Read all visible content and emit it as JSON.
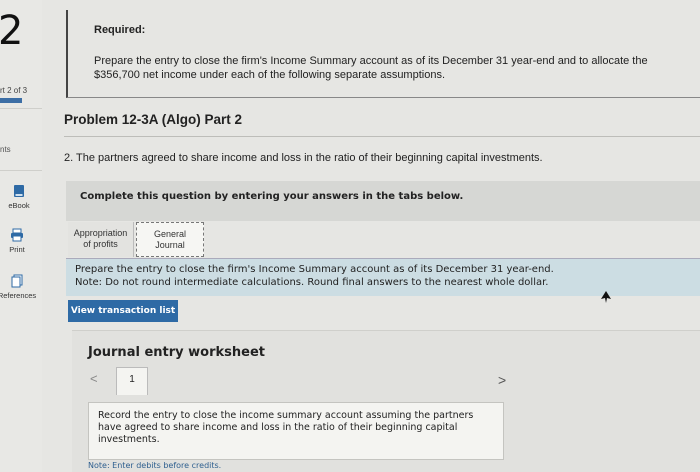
{
  "sidebar": {
    "question_number": "2",
    "part_label": "rt 2 of 3",
    "points_label": "nts",
    "tools": [
      {
        "label": "eBook",
        "icon": "book-icon"
      },
      {
        "label": "Print",
        "icon": "printer-icon"
      },
      {
        "label": "References",
        "icon": "references-icon"
      }
    ]
  },
  "required": {
    "title": "Required:",
    "text": "Prepare the entry to close the firm's Income Summary account as of its December 31 year-end and to allocate the $356,700 net income under each of the following separate assumptions."
  },
  "problem": {
    "title": "Problem 12-3A (Algo) Part 2",
    "question": "2. The partners agreed to share income and loss in the ratio of their beginning capital investments."
  },
  "instruction": "Complete this question by entering your answers in the tabs below.",
  "tabs": [
    {
      "line1": "Appropriation",
      "line2": "of profits"
    },
    {
      "line1": "General",
      "line2": "Journal"
    }
  ],
  "panel": {
    "line1": "Prepare the entry to close the firm's Income Summary account as of its December 31 year-end.",
    "line2": "Note: Do not round intermediate calculations. Round final answers to the nearest whole dollar."
  },
  "view_button": "View transaction list",
  "worksheet": {
    "title": "Journal entry worksheet",
    "prev": "<",
    "page": "1",
    "next": ">",
    "record_text": "Record the entry to close the income summary account assuming the partners have agreed to share income and loss in the ratio of their beginning capital investments.",
    "note": "Note: Enter debits before credits."
  },
  "colors": {
    "accent": "#2e6aa5",
    "panel": "#ccdde3",
    "background": "#e6e6e3"
  }
}
